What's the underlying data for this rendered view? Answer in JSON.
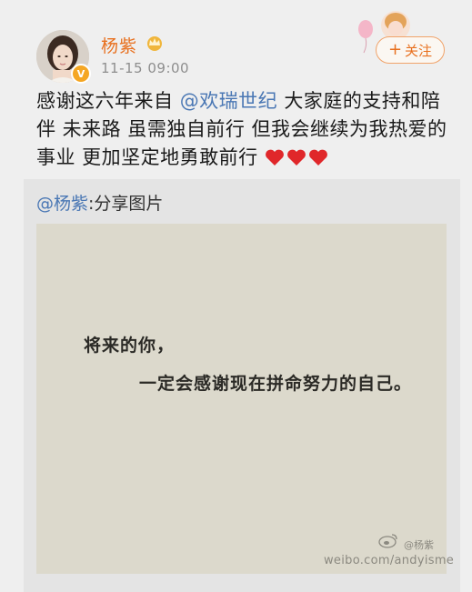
{
  "header": {
    "user_name": "杨紫",
    "time": "11-15 09:00",
    "follow_label": "关注",
    "follow_plus": "+"
  },
  "post": {
    "text_before": "感谢这六年来自 ",
    "mention": "@欢瑞世纪",
    "text_after": " 大家庭的支持和陪伴 未来路 虽需独自前行 但我会继续为我热爱的事业 更加坚定地勇敢前行",
    "heart_count": 3
  },
  "shared": {
    "author": "@杨紫",
    "suffix": ":分享图片",
    "quote_line1": "将来的你，",
    "quote_line2": "一定会感谢现在拼命努力的自己。",
    "watermark_name": "@杨紫",
    "watermark_url": "weibo.com/andyisme"
  },
  "colors": {
    "accent": "#e8701f",
    "mention": "#4a77b4",
    "heart": "#e0272a",
    "image_bg": "#dcd9cc"
  },
  "icons": [
    "crown-icon",
    "verified-badge-icon",
    "heart-icon",
    "weibo-logo-icon",
    "balloon-decoration-icon"
  ]
}
